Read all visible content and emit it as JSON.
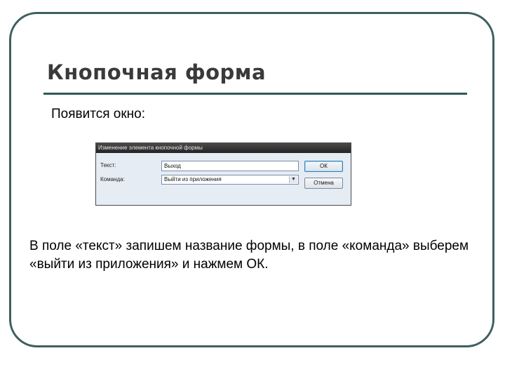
{
  "slide": {
    "title": "Кнопочная форма",
    "subtitle": "Появится окно:",
    "body": "В поле «текст» запишем название формы, в поле «команда» выберем «выйти из приложения» и нажмем ОК."
  },
  "dialog": {
    "title": "Изменение элемента кнопочной формы",
    "text_label": "Текст:",
    "text_value": "Выход",
    "command_label": "Команда:",
    "command_value": "Выйти из приложения",
    "ok_label": "ОК",
    "cancel_label": "Отмена"
  },
  "colors": {
    "frame": "#3f5f5f",
    "title_rule": "#2f5a5a",
    "title_text": "#3a3a3a"
  }
}
